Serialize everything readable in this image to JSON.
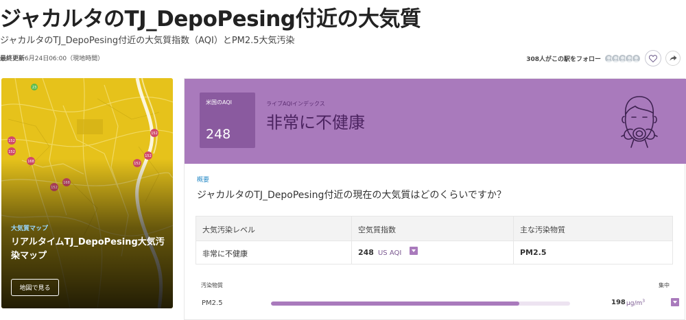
{
  "page": {
    "title": "ジャカルタのTJ_DepoPesing付近の大気質",
    "subtitle": "ジャカルタのTJ_DepoPesing付近の大気質指数（AQI）とPM2.5大気汚染",
    "last_updated_label": "最終更新",
    "last_updated_value": "6月24日06:00（現地時間）"
  },
  "follow": {
    "text": "308人がこの駅をフォロー",
    "avatar_count": 5,
    "heart_icon": "heart-icon",
    "share_icon": "share-icon"
  },
  "map_card": {
    "kicker": "大気質マップ",
    "title": "リアルタイムTJ_DepoPesing大気汚染マップ",
    "button": "地図で見る",
    "markers": [
      "23",
      "152",
      "152",
      "168",
      "152",
      "152",
      "152",
      "168",
      "152"
    ]
  },
  "aqi": {
    "box_label": "米国のAQI",
    "value": "248",
    "live_label": "ライブAQIインデックス",
    "status": "非常に不健康",
    "header_color": "#a97abc",
    "box_color": "#8a5a9f",
    "face_icon": "gas-mask-icon"
  },
  "overview": {
    "kicker": "概要",
    "question": "ジャカルタのTJ_DepoPesing付近の現在の大気質はどのくらいですか？"
  },
  "summary_table": {
    "headers": [
      "大気汚染レベル",
      "空気質指数",
      "主な汚染物質"
    ],
    "level": "非常に不健康",
    "aqi_value": "248",
    "aqi_unit": "US AQI",
    "main_pollutant": "PM2.5"
  },
  "pollutants": {
    "header_left": "汚染物質",
    "header_right": "集中",
    "rows": [
      {
        "name": "PM2.5",
        "value": "198",
        "unit": "µg/m",
        "unit_sup": "3",
        "fill_fraction": 0.83
      }
    ]
  }
}
